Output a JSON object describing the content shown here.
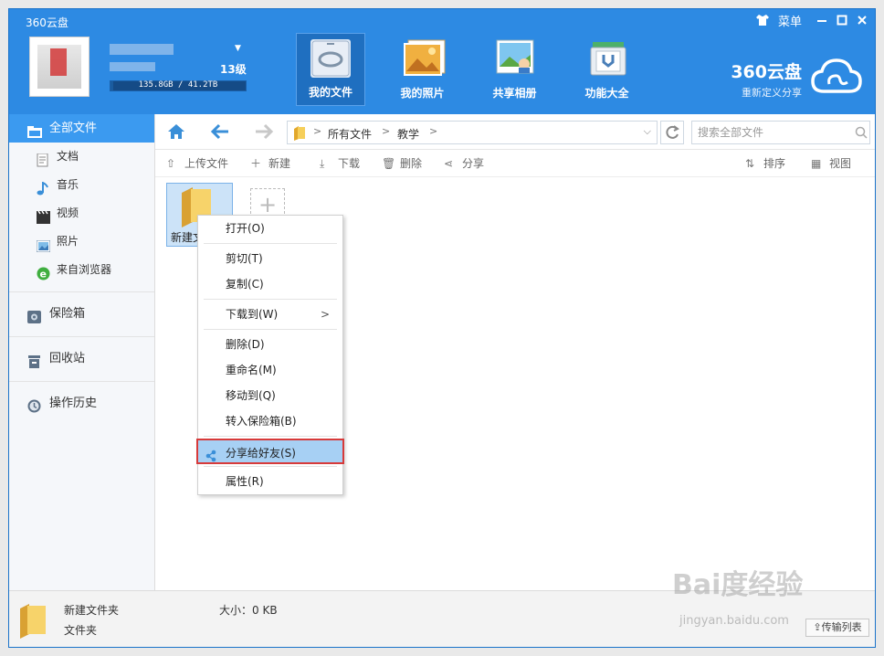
{
  "app": {
    "title": "360云盘",
    "menu_label": "菜单"
  },
  "user": {
    "level": "13级",
    "quota": "135.8GB / 41.2TB",
    "quota_used_fraction": 0.003
  },
  "nav": [
    {
      "label": "我的文件",
      "icon": "my-files-icon",
      "active": true
    },
    {
      "label": "我的照片",
      "icon": "photos-icon",
      "active": false
    },
    {
      "label": "共享相册",
      "icon": "shared-album-icon",
      "active": false
    },
    {
      "label": "功能大全",
      "icon": "tools-icon",
      "active": false
    }
  ],
  "brand": {
    "name": "360云盘",
    "slogan": "重新定义分享"
  },
  "sidebar": {
    "all_files": "全部文件",
    "subitems": [
      {
        "label": "文档",
        "icon": "document-icon"
      },
      {
        "label": "音乐",
        "icon": "music-icon"
      },
      {
        "label": "视频",
        "icon": "video-icon"
      },
      {
        "label": "照片",
        "icon": "photo-icon"
      },
      {
        "label": "来自浏览器",
        "icon": "browser-icon"
      }
    ],
    "safe": "保险箱",
    "recycle": "回收站",
    "history": "操作历史"
  },
  "breadcrumb": [
    "所有文件",
    "教学"
  ],
  "search": {
    "placeholder": "搜索全部文件"
  },
  "toolbar": {
    "upload": "上传文件",
    "new": "新建",
    "download": "下载",
    "delete": "删除",
    "share": "分享",
    "sort": "排序",
    "view": "视图"
  },
  "file": {
    "name_truncated": "新建文"
  },
  "context_menu": {
    "open": "打开(O)",
    "cut": "剪切(T)",
    "copy": "复制(C)",
    "download_to": "下载到(W)",
    "delete": "删除(D)",
    "rename": "重命名(M)",
    "move_to": "移动到(Q)",
    "to_safe": "转入保险箱(B)",
    "share_friend": "分享给好友(S)",
    "properties": "属性(R)"
  },
  "status": {
    "name": "新建文件夹",
    "type": "文件夹",
    "size": "大小：0 KB",
    "transfer": "传输列表"
  },
  "watermark": {
    "main": "Bai度经验",
    "sub": "jingyan.baidu.com"
  },
  "colors": {
    "header": "#2d8ae3",
    "active_side": "#3b9af0",
    "highlight": "#a7d0f4",
    "outline": "#d73a3a"
  }
}
